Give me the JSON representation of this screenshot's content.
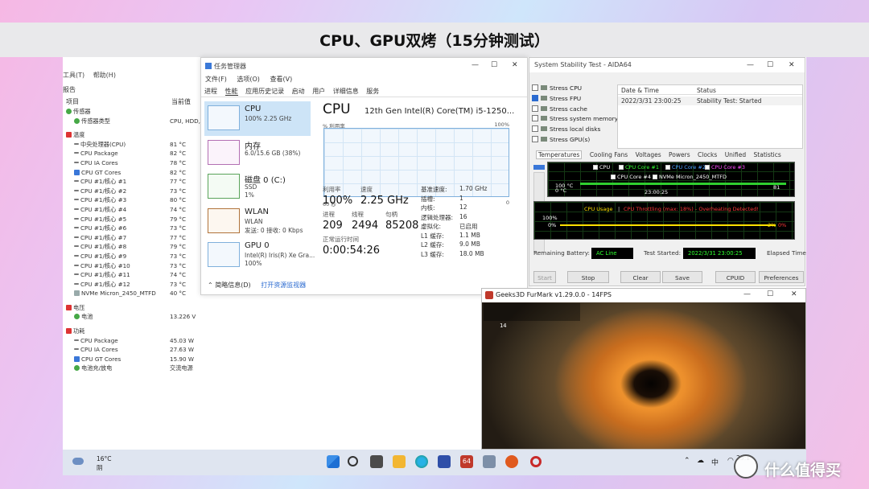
{
  "banner": {
    "title": "CPU、GPU双烤（15分钟测试）"
  },
  "sensor_panel": {
    "menu": [
      "工具(T)",
      "帮助(H)"
    ],
    "report_label": "报告",
    "col_item": "项目",
    "col_value": "当前值",
    "rows": [
      {
        "label": "传感器",
        "value": "",
        "level": 1,
        "icon": "sensor-icon"
      },
      {
        "label": "传感器类型",
        "value": "CPU, HDD, ...",
        "level": 2,
        "icon": "sensor-type-icon"
      },
      {
        "gap": true
      },
      {
        "label": "温度",
        "value": "",
        "level": 1,
        "icon": "thermometer-icon"
      },
      {
        "label": "中央处理器(CPU)",
        "value": "81 °C",
        "level": 2,
        "icon": "cpu-icon"
      },
      {
        "label": "CPU Package",
        "value": "82 °C",
        "level": 2,
        "icon": "cpu-icon"
      },
      {
        "label": "CPU IA Cores",
        "value": "78 °C",
        "level": 2,
        "icon": "cpu-icon"
      },
      {
        "label": "CPU GT Cores",
        "value": "82 °C",
        "level": 2,
        "icon": "gpu-chip-icon"
      },
      {
        "label": "CPU #1/核心 #1",
        "value": "77 °C",
        "level": 2,
        "icon": "cpu-icon"
      },
      {
        "label": "CPU #1/核心 #2",
        "value": "73 °C",
        "level": 2,
        "icon": "cpu-icon"
      },
      {
        "label": "CPU #1/核心 #3",
        "value": "80 °C",
        "level": 2,
        "icon": "cpu-icon"
      },
      {
        "label": "CPU #1/核心 #4",
        "value": "74 °C",
        "level": 2,
        "icon": "cpu-icon"
      },
      {
        "label": "CPU #1/核心 #5",
        "value": "79 °C",
        "level": 2,
        "icon": "cpu-icon"
      },
      {
        "label": "CPU #1/核心 #6",
        "value": "73 °C",
        "level": 2,
        "icon": "cpu-icon"
      },
      {
        "label": "CPU #1/核心 #7",
        "value": "77 °C",
        "level": 2,
        "icon": "cpu-icon"
      },
      {
        "label": "CPU #1/核心 #8",
        "value": "79 °C",
        "level": 2,
        "icon": "cpu-icon"
      },
      {
        "label": "CPU #1/核心 #9",
        "value": "73 °C",
        "level": 2,
        "icon": "cpu-icon"
      },
      {
        "label": "CPU #1/核心 #10",
        "value": "73 °C",
        "level": 2,
        "icon": "cpu-icon"
      },
      {
        "label": "CPU #1/核心 #11",
        "value": "74 °C",
        "level": 2,
        "icon": "cpu-icon"
      },
      {
        "label": "CPU #1/核心 #12",
        "value": "73 °C",
        "level": 2,
        "icon": "cpu-icon"
      },
      {
        "label": "NVMe Micron_2450_MTFD",
        "value": "40 °C",
        "level": 2,
        "icon": "disk-icon"
      },
      {
        "gap": true
      },
      {
        "label": "电压",
        "value": "",
        "level": 1,
        "icon": "voltage-icon"
      },
      {
        "label": "电池",
        "value": "13.226 V",
        "level": 2,
        "icon": "battery-icon"
      },
      {
        "gap": true
      },
      {
        "label": "功耗",
        "value": "",
        "level": 1,
        "icon": "power-icon"
      },
      {
        "label": "CPU Package",
        "value": "45.03 W",
        "level": 2,
        "icon": "cpu-icon"
      },
      {
        "label": "CPU IA Cores",
        "value": "27.63 W",
        "level": 2,
        "icon": "cpu-icon"
      },
      {
        "label": "CPU GT Cores",
        "value": "15.90 W",
        "level": 2,
        "icon": "gpu-chip-icon"
      },
      {
        "label": "电池充/放电",
        "value": "交流电源",
        "level": 2,
        "icon": "battery-icon"
      }
    ]
  },
  "task_manager": {
    "title": "任务管理器",
    "menu": [
      "文件(F)",
      "选项(O)",
      "查看(V)"
    ],
    "tabs": [
      "进程",
      "性能",
      "应用历史记录",
      "启动",
      "用户",
      "详细信息",
      "服务"
    ],
    "active_tab": "性能",
    "resources": [
      {
        "name": "CPU",
        "sub": "100%  2.25 GHz",
        "sub2": ""
      },
      {
        "name": "内存",
        "sub": "6.0/15.6 GB (38%)",
        "sub2": ""
      },
      {
        "name": "磁盘 0 (C:)",
        "sub": "SSD",
        "sub2": "1%"
      },
      {
        "name": "WLAN",
        "sub": "WLAN",
        "sub2": "发送: 0 接收: 0 Kbps"
      },
      {
        "name": "GPU 0",
        "sub": "Intel(R) Iris(R) Xe Gra...",
        "sub2": "100%"
      }
    ],
    "main": {
      "heading": "CPU",
      "model": "12th Gen Intel(R) Core(TM) i5-1250...",
      "util_label": "% 利用率",
      "max_label": "100%",
      "time_label": "60 秒",
      "zero_label": "0",
      "stats": [
        {
          "k": "利用率",
          "v": "100%"
        },
        {
          "k": "速度",
          "v": "2.25 GHz"
        },
        {
          "k": "进程",
          "v": "209"
        },
        {
          "k": "线程",
          "v": "2494"
        },
        {
          "k": "句柄",
          "v": "85208"
        },
        {
          "k": "正常运行时间",
          "v": "0:00:54:26"
        }
      ],
      "specs": [
        {
          "k": "基准速度:",
          "v": "1.70 GHz"
        },
        {
          "k": "插槽:",
          "v": "1"
        },
        {
          "k": "内核:",
          "v": "12"
        },
        {
          "k": "逻辑处理器:",
          "v": "16"
        },
        {
          "k": "虚拟化:",
          "v": "已启用"
        },
        {
          "k": "L1 缓存:",
          "v": "1.1 MB"
        },
        {
          "k": "L2 缓存:",
          "v": "9.0 MB"
        },
        {
          "k": "L3 缓存:",
          "v": "18.0 MB"
        }
      ]
    },
    "footer": {
      "less": "简略信息(D)",
      "open": "打开资源监视器"
    }
  },
  "aida": {
    "title": "System Stability Test - AIDA64",
    "checks": [
      {
        "label": "Stress CPU",
        "on": false
      },
      {
        "label": "Stress FPU",
        "on": true
      },
      {
        "label": "Stress cache",
        "on": false
      },
      {
        "label": "Stress system memory",
        "on": false
      },
      {
        "label": "Stress local disks",
        "on": false
      },
      {
        "label": "Stress GPU(s)",
        "on": false
      }
    ],
    "log_headers": [
      "Date & Time",
      "Status"
    ],
    "log_row": [
      "2022/3/31 23:00:25",
      "Stability Test: Started"
    ],
    "tabs": [
      "Temperatures",
      "Cooling Fans",
      "Voltages",
      "Powers",
      "Clocks",
      "Unified",
      "Statistics"
    ],
    "graph1": {
      "legend": [
        "CPU",
        "CPU Core #1",
        "CPU Core #2",
        "CPU Core #3",
        "CPU Core #4",
        "NVMe Micron_2450_MTFD"
      ],
      "legend_colors": [
        "#ffffff",
        "#32ff32",
        "#4aa0ff",
        "#ff4aff",
        "#ffffff",
        "#ffffff"
      ],
      "top": "100 °C",
      "bottom": "0 °C",
      "time": "23:00:25",
      "value": "81"
    },
    "graph2": {
      "title_a": "CPU Usage",
      "title_sep": "|",
      "title_b": "CPU Throttling (max: 18%) - Overheating Detected!",
      "top": "100%",
      "bottom": "0%",
      "value_a": "2%",
      "value_b": "0%"
    },
    "status": {
      "battery_label": "Remaining Battery:",
      "battery_value": "AC Line",
      "started_label": "Test Started:",
      "started_value": "2022/3/31 23:00:25",
      "elapsed_label": "Elapsed Time"
    },
    "buttons": [
      "Start",
      "Stop",
      "Clear",
      "Save",
      "CPUID",
      "Preferences"
    ]
  },
  "furmark": {
    "title": "Geeks3D FurMark v1.29.0.0 - 14FPS",
    "fps": "14"
  },
  "taskbar": {
    "weather_temp": "16°C",
    "weather_cond": "阴",
    "ime": "中",
    "clock": "23:1"
  },
  "watermark": {
    "text": "什么值得买"
  }
}
